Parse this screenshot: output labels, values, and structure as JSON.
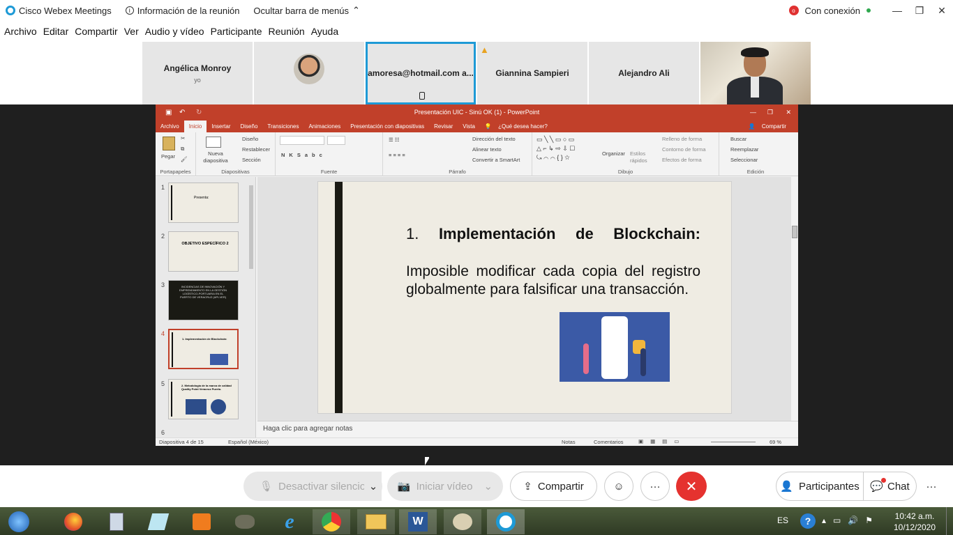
{
  "titlebar": {
    "app_name": "Cisco Webex Meetings",
    "info_label": "Información de la reunión",
    "hide_menu_label": "Ocultar barra de menús",
    "status": "Con conexión"
  },
  "menu": [
    "Archivo",
    "Editar",
    "Compartir",
    "Ver",
    "Audio y vídeo",
    "Participante",
    "Reunión",
    "Ayuda"
  ],
  "participants": [
    {
      "name": "Angélica Monroy",
      "sub": "yo"
    },
    {
      "name": ""
    },
    {
      "name": "amoresa@hotmail.com a..."
    },
    {
      "name": "Giannina Sampieri"
    },
    {
      "name": "Alejandro Ali"
    },
    {
      "name": ""
    }
  ],
  "ppt": {
    "window_title": "Presentación UIC - Sinú OK (1) - PowerPoint",
    "tabs": [
      "Archivo",
      "Inicio",
      "Insertar",
      "Diseño",
      "Transiciones",
      "Animaciones",
      "Presentación con diapositivas",
      "Revisar",
      "Vista",
      "¿Qué desea hacer?"
    ],
    "share_label": "Compartir",
    "groups": {
      "portapapeles": "Portapapeles",
      "diapositivas": "Diapositivas",
      "fuente": "Fuente",
      "parrafo": "Párrafo",
      "dibujo": "Dibujo",
      "edicion": "Edición"
    },
    "ribbon_items": {
      "pegar": "Pegar",
      "nueva": "Nueva diapositiva",
      "diseno": "Diseño",
      "restablecer": "Restablecer",
      "seccion": "Sección",
      "direccion": "Dirección del texto",
      "alinear": "Alinear texto",
      "smartart": "Convertir a SmartArt",
      "organizar": "Organizar",
      "estilos": "Estilos rápidos",
      "relleno": "Relleno de forma",
      "contorno": "Contorno de forma",
      "efectos": "Efectos de forma",
      "buscar": "Buscar",
      "reemplazar": "Reemplazar",
      "seleccionar": "Seleccionar"
    },
    "thumbnails": [
      {
        "num": "1",
        "text": "Presenta:"
      },
      {
        "num": "2",
        "text": "OBJETIVO ESPECÍFICO 2"
      },
      {
        "num": "3",
        "text": "INCIDENCIAS DE INNOVACIÓN Y EMPRENDIMIENTO EN LA GESTIÓN LOGÍSTICO-PORTUARIA EN EL PUERTO DE VERACRUZ (API-VER)"
      },
      {
        "num": "4",
        "text": "1. Implementación de Blockchain:"
      },
      {
        "num": "5",
        "text": "2. Metodología de la marca de calidad Quality Point Veracruz Puerto."
      },
      {
        "num": "6",
        "text": ""
      }
    ],
    "slide": {
      "num": "1.",
      "heading": [
        "Implementación",
        "de",
        "Blockchain:"
      ],
      "body": "Imposible modificar cada copia del registro globalmente para falsificar una transacción."
    },
    "notes_placeholder": "Haga clic para agregar notas",
    "status": {
      "slide_count": "Diapositiva 4 de 15",
      "language": "Español (México)",
      "notes": "Notas",
      "comments": "Comentarios",
      "zoom": "69 %"
    }
  },
  "controls": {
    "mute": "Desactivar silencio",
    "video": "Iniciar vídeo",
    "share": "Compartir",
    "participants": "Participantes",
    "chat": "Chat"
  },
  "taskbar": {
    "lang": "ES",
    "time": "10:42 a.m.",
    "date": "10/12/2020"
  }
}
